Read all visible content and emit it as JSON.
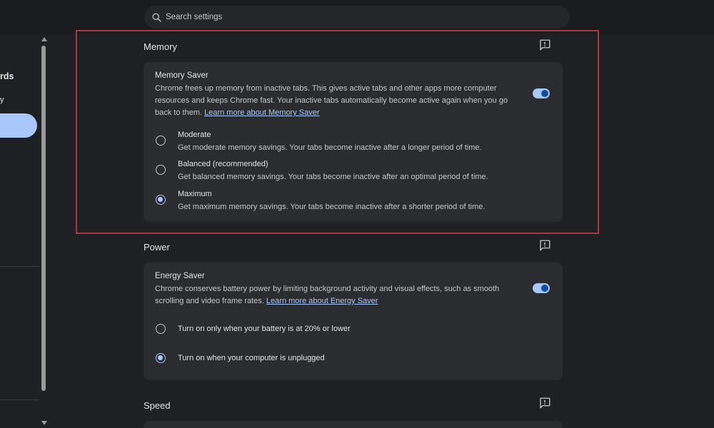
{
  "search": {
    "placeholder": "Search settings"
  },
  "sidebar": {
    "partial_item_1": "rds",
    "partial_item_2": "y"
  },
  "memory": {
    "section_title": "Memory",
    "card_title": "Memory Saver",
    "description": "Chrome frees up memory from inactive tabs. This gives active tabs and other apps more computer resources and keeps Chrome fast. Your inactive tabs automatically become active again when you go back to them.",
    "learn_more": "Learn more about Memory Saver",
    "toggle_on": true,
    "options": [
      {
        "label": "Moderate",
        "desc": "Get moderate memory savings. Your tabs become inactive after a longer period of time.",
        "checked": false
      },
      {
        "label": "Balanced (recommended)",
        "desc": "Get balanced memory savings. Your tabs become inactive after an optimal period of time.",
        "checked": false
      },
      {
        "label": "Maximum",
        "desc": "Get maximum memory savings. Your tabs become inactive after a shorter period of time.",
        "checked": true
      }
    ]
  },
  "power": {
    "section_title": "Power",
    "card_title": "Energy Saver",
    "description": "Chrome conserves battery power by limiting background activity and visual effects, such as smooth scrolling and video frame rates.",
    "learn_more": "Learn more about Energy Saver",
    "toggle_on": true,
    "options": [
      {
        "label": "Turn on only when your battery is at 20% or lower",
        "checked": false
      },
      {
        "label": "Turn on when your computer is unplugged",
        "checked": true
      }
    ]
  },
  "speed": {
    "section_title": "Speed"
  },
  "colors": {
    "accent": "#a8c7fa",
    "highlight_border": "#a8383d",
    "card_bg": "#2b2c30"
  }
}
